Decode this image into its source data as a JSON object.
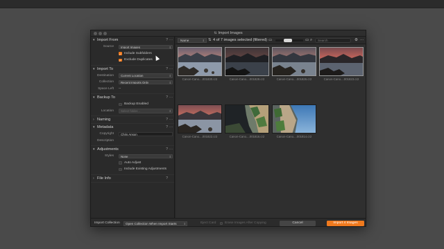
{
  "window": {
    "title": "Import Images",
    "title_icon": "import-icon"
  },
  "sidebar": {
    "import_from": {
      "title": "Import From",
      "source_label": "Source",
      "source_value": "Import Images",
      "include_subfolders": {
        "label": "Include Subfolders",
        "checked": true
      },
      "exclude_duplicates": {
        "label": "Exclude Duplicates",
        "checked": true
      }
    },
    "import_to": {
      "title": "Import To",
      "destination_label": "Destination",
      "destination_value": "Current Location",
      "collection_label": "Collection",
      "collection_value": "Recent Imports Only",
      "space_left_label": "Space Left",
      "space_left_value": "--"
    },
    "backup_to": {
      "title": "Backup To",
      "backup_enabled": {
        "label": "Backup Enabled",
        "checked": false
      },
      "location_label": "Location",
      "location_placeholder": "Select folder..."
    },
    "naming": {
      "title": "Naming"
    },
    "metadata": {
      "title": "Metadata",
      "copyright_label": "Copyright",
      "copyright_value": "Chris Anson",
      "description_label": "Description"
    },
    "adjustments": {
      "title": "Adjustments",
      "styles_label": "Styles",
      "styles_value": "None",
      "auto_adjust": {
        "label": "Auto Adjust",
        "checked": false
      },
      "include_existing": {
        "label": "Include Existing Adjustments",
        "checked": false
      }
    },
    "file_info": {
      "title": "File Info"
    },
    "help_glyph": "?",
    "more_glyph": "···"
  },
  "toolbar": {
    "sort_value": "Name",
    "selection_count": "4 of 7 images selected (filtered)",
    "search_placeholder": "Search"
  },
  "images": [
    {
      "caption": "Canon-Cano....001830.cr2",
      "selected": true,
      "scene": "lake-dusk-pink"
    },
    {
      "caption": "Canon-Cano....001828.cr2",
      "selected": true,
      "scene": "lake-dark"
    },
    {
      "caption": "Canon-Cano....001826.cr2",
      "selected": true,
      "scene": "lake-dusk-pink"
    },
    {
      "caption": "Canon-Cano....001823.cr2",
      "selected": true,
      "scene": "lake-red-sky"
    },
    {
      "caption": "Canon-Cano....001822.cr2",
      "selected": false,
      "scene": "lake-red-sky"
    },
    {
      "caption": "Canon-Cano....001816.cr2",
      "selected": false,
      "scene": "cliff-trees"
    },
    {
      "caption": "Canon-Cano....001814.cr2",
      "selected": false,
      "scene": "cliff-sky"
    }
  ],
  "footer": {
    "import_collection_label": "Import Collection",
    "open_collection_value": "Open Collection When Import Starts",
    "eject_card_label": "Eject Card",
    "erase_after_copy_label": "Erase Images After Copying",
    "cancel_label": "Cancel",
    "import_label": "Import 4 Images"
  },
  "colors": {
    "accent": "#f07a1e",
    "panel": "#2a2a2a",
    "background": "#4a4a4a"
  }
}
